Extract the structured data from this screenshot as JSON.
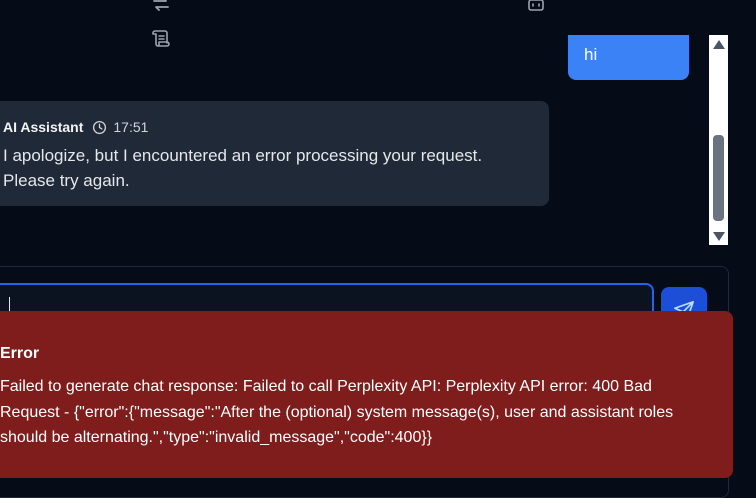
{
  "toolbar": {
    "icons": [
      "repeat-icon",
      "scroll-text-icon",
      "bot-icon"
    ]
  },
  "messages": {
    "user": {
      "text": "hi"
    },
    "assistant": {
      "sender": "AI Assistant",
      "time": "17:51",
      "text": "I apologize, but I encountered an error processing your request. Please try again."
    }
  },
  "composer": {
    "value": "",
    "send_icon": "send-icon"
  },
  "error_toast": {
    "title": "Error",
    "message": "Failed to generate chat response: Failed to call Perplexity API: Perplexity API error: 400 Bad Request - {\"error\":{\"message\":\"After the (optional) system message(s), user and assistant roles should be alternating.\",\"type\":\"invalid_message\",\"code\":400}}"
  },
  "colors": {
    "background": "#050b17",
    "user_bubble": "#3b82f6",
    "assistant_bubble": "#1f2937",
    "error": "#7f1d1d",
    "focus_ring": "#2563eb"
  }
}
